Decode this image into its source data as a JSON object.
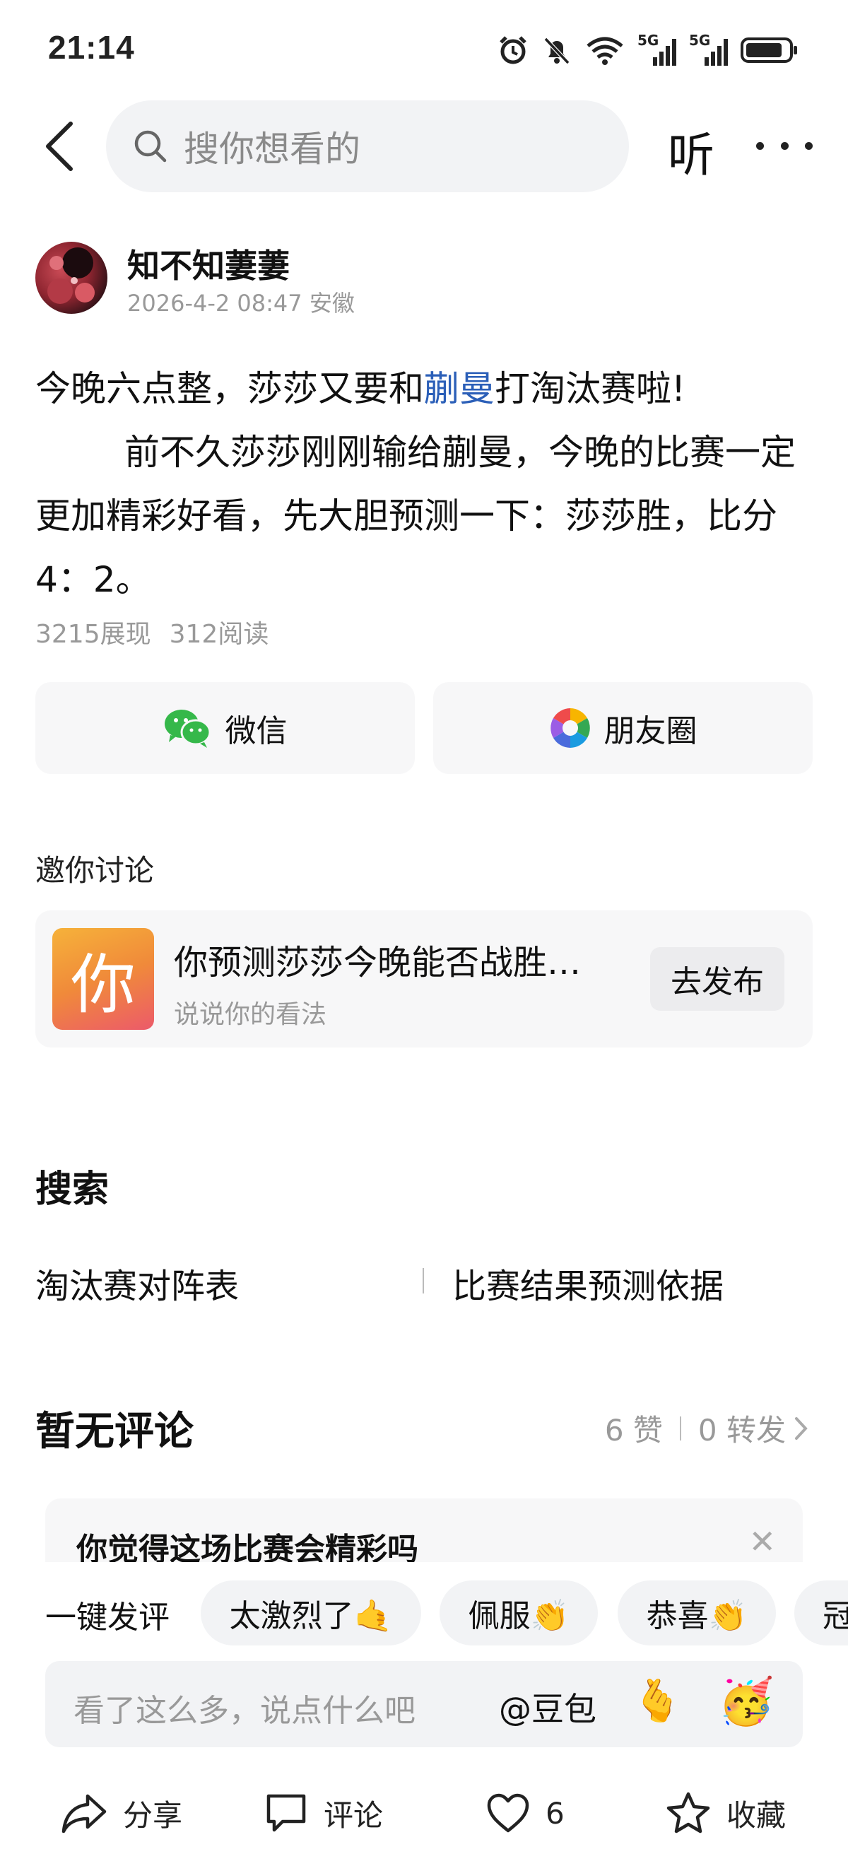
{
  "status_bar": {
    "time": "21:14",
    "net1": "5G",
    "net2": "5G"
  },
  "header": {
    "search_placeholder": "搜你想看的",
    "listen_label": "听"
  },
  "post": {
    "author_name": "知不知萋萋",
    "timestamp": "2026-4-2 08:47",
    "location": "安徽",
    "line1_before": "今晚六点整，莎莎又要和",
    "line1_link": "蒯曼",
    "line1_after": "打淘汰赛啦!",
    "paragraph2": "前不久莎莎刚刚输给蒯曼，今晚的比赛一定更加精彩好看，先大胆预测一下：莎莎胜，比分4：2。",
    "views": "3215展现",
    "reads": "312阅读"
  },
  "share": {
    "wechat_label": "微信",
    "moments_label": "朋友圈"
  },
  "invite": {
    "section_title": "邀你讨论",
    "icon_char": "你",
    "question": "你预测莎莎今晚能否战胜…",
    "subtitle": "说说你的看法",
    "publish_label": "去发布"
  },
  "search_section": {
    "title": "搜索",
    "links": [
      "淘汰赛对阵表",
      "比赛结果预测依据"
    ]
  },
  "comments": {
    "title": "暂无评论",
    "likes": "6 赞",
    "reposts": "0 转发",
    "poll_text": "你觉得这场比赛会精彩吗",
    "quick_label": "一键发评",
    "chips": [
      "太激烈了🤙",
      "佩服👏",
      "恭喜👏",
      "冠"
    ],
    "input_placeholder": "看了这么多，说点什么吧",
    "mention": "@豆包",
    "emoji1": "🫰",
    "emoji2": "🥳"
  },
  "bottom_bar": {
    "share_label": "分享",
    "comment_label": "评论",
    "like_count": "6",
    "favorite_label": "收藏"
  }
}
